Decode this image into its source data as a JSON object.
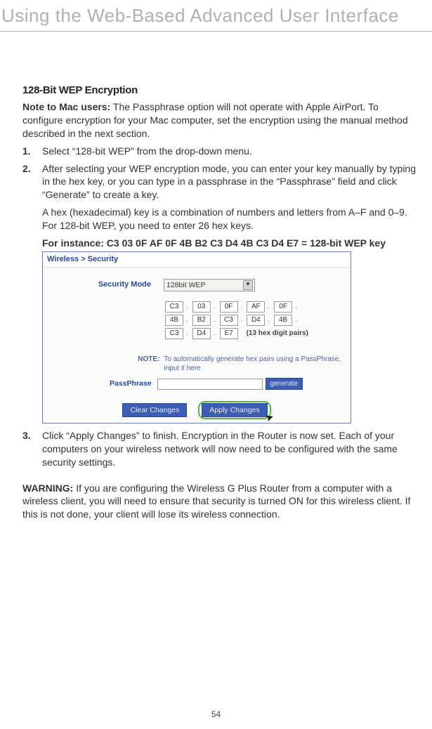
{
  "header": "Using the Web-Based Advanced User Interface",
  "section_title": "128-Bit WEP Encryption",
  "note": {
    "label": "Note to Mac users:",
    "text": " The Passphrase option will not operate with Apple AirPort. To configure encryption for your Mac computer, set the encryption using the manual method described in the next section."
  },
  "steps": {
    "s1": "Select “128-bit WEP” from the drop-down menu.",
    "s2": "After selecting your WEP encryption mode, you can enter your key manually by typing in the hex key, or you can type in a passphrase in the “Passphrase” field and click “Generate” to create a key.",
    "s2_sub": "A hex (hexadecimal) key is a combination of numbers and letters from A–F and 0–9. For 128-bit WEP, you need to enter 26 hex keys.",
    "s2_example": "For instance:  C3 03 0F AF 0F 4B B2 C3 D4 4B C3 D4 E7 = 128-bit WEP key",
    "s3": "Click “Apply Changes” to finish. Encryption in the Router is now set. Each of your computers on your wireless network will now need to be configured with the same security settings."
  },
  "router": {
    "breadcrumb": "Wireless > Security",
    "security_mode_label": "Security Mode",
    "security_mode_value": "128bit WEP",
    "hex": {
      "r1": [
        "C3",
        "03",
        "0F",
        "AF",
        "0F"
      ],
      "r2": [
        "4B",
        "B2",
        "C3",
        "D4",
        "4B"
      ],
      "r3": [
        "C3",
        "D4",
        "E7"
      ]
    },
    "hex_note": "(13 hex digit pairs)",
    "note_prefix": "NOTE:",
    "note_text": "To automatically generate hex pairs using a PassPhrase, input it here",
    "passphrase_label": "PassPhrase",
    "generate_btn": "generate",
    "clear_btn": "Clear Changes",
    "apply_btn": "Apply Changes"
  },
  "warning": {
    "label": "WARNING:",
    "text": " If you are configuring the Wireless G Plus Router from a computer with a wireless client, you will need to ensure that security is turned ON for this wireless client. If this is not done, your client will lose its wireless connection."
  },
  "page_number": "54"
}
